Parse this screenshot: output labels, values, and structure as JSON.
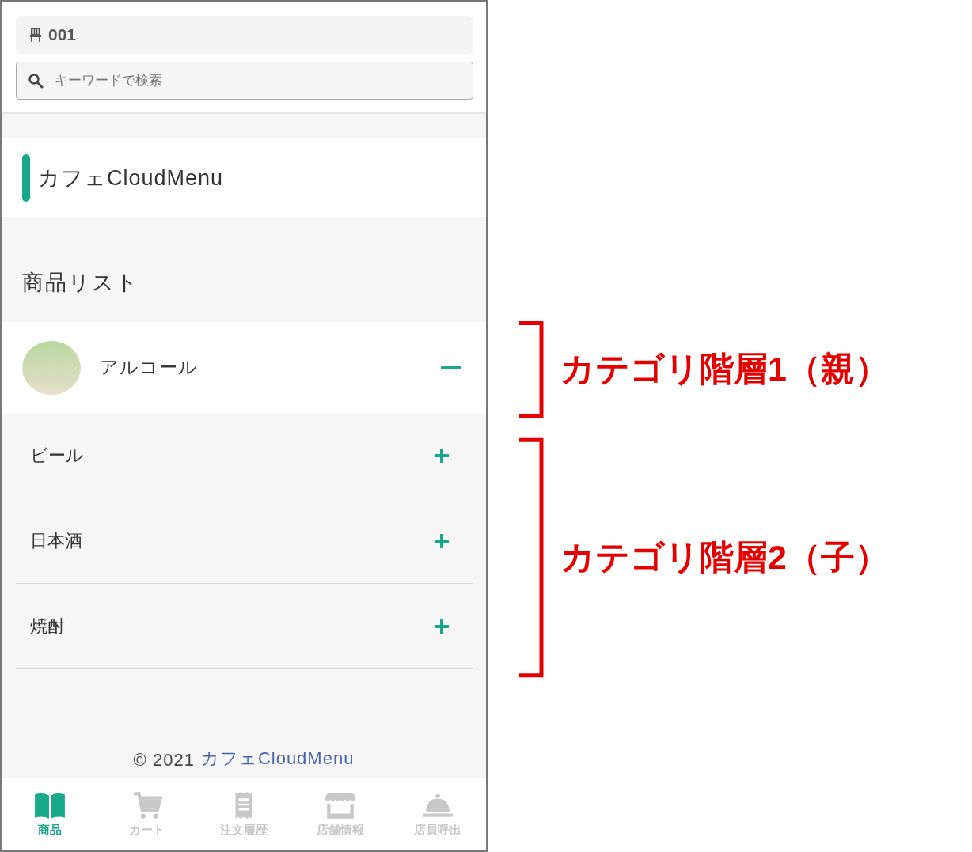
{
  "table_badge": {
    "number": "001"
  },
  "search": {
    "placeholder": "キーワードで検索"
  },
  "shop_name": "カフェCloudMenu",
  "section_title": "商品リスト",
  "categories": [
    {
      "name": "アルコール",
      "expanded": true,
      "children": [
        {
          "name": "ビール",
          "expanded": false
        },
        {
          "name": "日本酒",
          "expanded": false
        },
        {
          "name": "焼酎",
          "expanded": false
        }
      ]
    }
  ],
  "footer": {
    "copyright": "© 2021",
    "link": "カフェCloudMenu"
  },
  "bottom_nav": [
    {
      "label": "商品",
      "kind": "book",
      "selected": true
    },
    {
      "label": "カート",
      "kind": "cart",
      "selected": false
    },
    {
      "label": "注文履歴",
      "kind": "receipt",
      "selected": false
    },
    {
      "label": "店舗情報",
      "kind": "store",
      "selected": false
    },
    {
      "label": "店員呼出",
      "kind": "bell",
      "selected": false
    }
  ],
  "annotations": [
    {
      "label": "カテゴリ階層1（親）"
    },
    {
      "label": "カテゴリ階層2（子）"
    }
  ]
}
